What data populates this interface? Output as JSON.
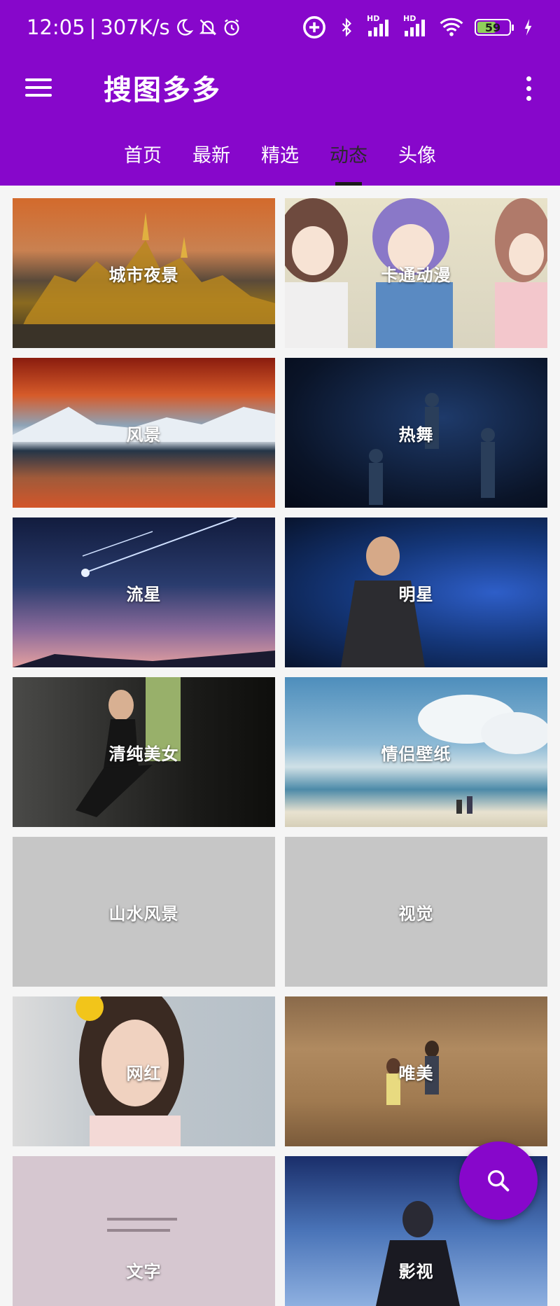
{
  "status_bar": {
    "time": "12:05",
    "separator": "|",
    "speed": "307K/s",
    "battery": "59",
    "icons": [
      "moon-icon",
      "bell-off-icon",
      "alarm-icon",
      "vpn-icon",
      "bluetooth-icon",
      "signal-hd-icon",
      "signal-hd-icon",
      "wifi-icon",
      "battery-icon",
      "charging-icon"
    ],
    "hd_label": "HD"
  },
  "toolbar": {
    "title": "搜图多多",
    "menu_icon": "menu-icon",
    "overflow_icon": "more-vert-icon"
  },
  "tabs": [
    {
      "label": "首页",
      "active": false
    },
    {
      "label": "最新",
      "active": false
    },
    {
      "label": "精选",
      "active": false
    },
    {
      "label": "动态",
      "active": true
    },
    {
      "label": "头像",
      "active": false
    }
  ],
  "categories": [
    {
      "label": "城市夜景"
    },
    {
      "label": "卡通动漫"
    },
    {
      "label": "风景"
    },
    {
      "label": "热舞"
    },
    {
      "label": "流星"
    },
    {
      "label": "明星"
    },
    {
      "label": "清纯美女"
    },
    {
      "label": "情侣壁纸"
    },
    {
      "label": "山水风景"
    },
    {
      "label": "视觉"
    },
    {
      "label": "网红"
    },
    {
      "label": "唯美"
    },
    {
      "label": "文字"
    },
    {
      "label": "影视"
    }
  ],
  "fab": {
    "icon": "search-icon"
  },
  "colors": {
    "primary": "#8707cb",
    "placeholder": "#c6c6c6"
  }
}
